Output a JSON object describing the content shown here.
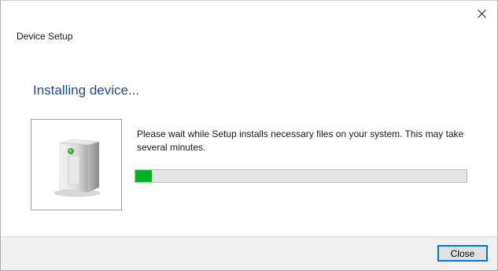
{
  "window": {
    "title": "Device Setup",
    "close_glyph": "✕"
  },
  "main": {
    "heading": "Installing device...",
    "message": "Please wait while Setup installs necessary files on your system. This may take several minutes.",
    "device_icon": "external-drive-icon"
  },
  "progress": {
    "fraction": 0.05,
    "fill_color": "#06b025"
  },
  "footer": {
    "close_label": "Close"
  },
  "colors": {
    "heading": "#1e4a9a",
    "button_focus_border": "#0078d7"
  }
}
